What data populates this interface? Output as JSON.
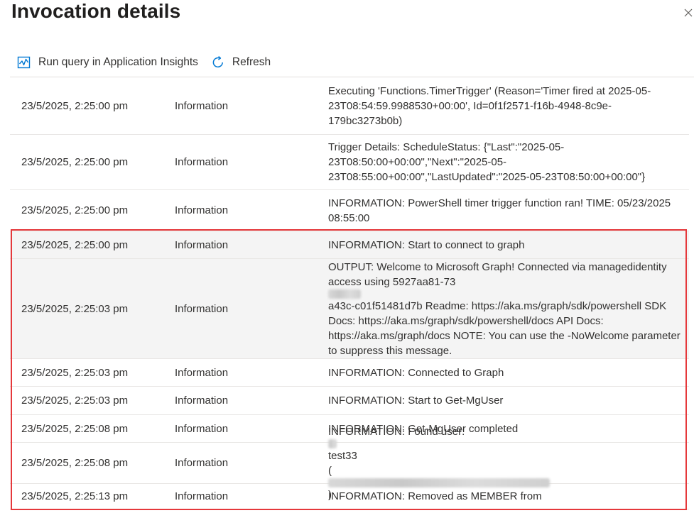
{
  "panel": {
    "title": "Invocation details",
    "close_label": "×"
  },
  "toolbar": {
    "run_query_label": "Run query in Application Insights",
    "refresh_label": "Refresh"
  },
  "colors": {
    "accent_blue": "#0078d4",
    "highlight_red": "#e5383b"
  },
  "logs": [
    {
      "time": "23/5/2025, 2:25:00 pm",
      "level": "Information",
      "message": "Executing 'Functions.TimerTrigger' (Reason='Timer fired at 2025-05-23T08:54:59.9988530+00:00', Id=0f1f2571-f16b-4948-8c9e-179bc3273b0b)"
    },
    {
      "time": "23/5/2025, 2:25:00 pm",
      "level": "Information",
      "message": "Trigger Details: ScheduleStatus: {\"Last\":\"2025-05-23T08:50:00+00:00\",\"Next\":\"2025-05-23T08:55:00+00:00\",\"LastUpdated\":\"2025-05-23T08:50:00+00:00\"}"
    },
    {
      "time": "23/5/2025, 2:25:00 pm",
      "level": "Information",
      "message": "INFORMATION: PowerShell timer trigger function ran! TIME: 05/23/2025 08:55:00"
    },
    {
      "time": "23/5/2025, 2:25:00 pm",
      "level": "Information",
      "message": "INFORMATION: Start to connect to graph"
    },
    {
      "time": "23/5/2025, 2:25:03 pm",
      "level": "Information",
      "message_pre": "OUTPUT: Welcome to Microsoft Graph! Connected via managedidentity access using 5927aa81-73",
      "message_post": "a43c-c01f51481d7b Readme: https://aka.ms/graph/sdk/powershell SDK Docs: https://aka.ms/graph/sdk/powershell/docs API Docs: https://aka.ms/graph/docs NOTE: You can use the -NoWelcome parameter to suppress this message."
    },
    {
      "time": "23/5/2025, 2:25:03 pm",
      "level": "Information",
      "message": "INFORMATION: Connected to Graph"
    },
    {
      "time": "23/5/2025, 2:25:03 pm",
      "level": "Information",
      "message": "INFORMATION: Start to Get-MgUser"
    },
    {
      "time": "23/5/2025, 2:25:08 pm",
      "level": "Information",
      "message": "INFORMATION: Get-MgUser completed"
    },
    {
      "time": "23/5/2025, 2:25:08 pm",
      "level": "Information",
      "message_pre": "INFORMATION: Found user: ",
      "message_post": "test33",
      "message_line2_open": "(",
      "message_line2_close": ")"
    },
    {
      "time": "23/5/2025, 2:25:13 pm",
      "level": "Information",
      "message": "INFORMATION: Removed as MEMBER from"
    }
  ]
}
